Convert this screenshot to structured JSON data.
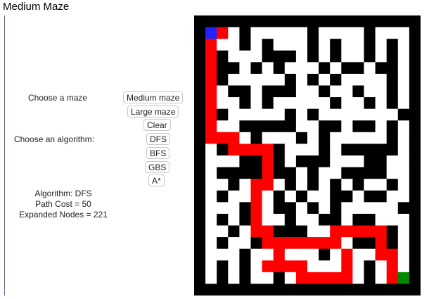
{
  "page_title": "Medium Maze",
  "controls": {
    "choose_maze_label": "Choose a maze",
    "choose_algorithm_label": "Choose an algorithm:",
    "buttons": {
      "medium_maze": "Medium maze",
      "large_maze": "Large  maze",
      "clear": "Clear",
      "dfs": "DFS",
      "bfs": "BFS",
      "gbs": "GBS",
      "astar": "A*"
    }
  },
  "results": {
    "algorithm": "Algorithm: DFS",
    "path_cost": "Path Cost = 50",
    "expanded_nodes": "Expanded Nodes = 221"
  },
  "maze": {
    "colors": {
      "wall": "#000000",
      "open": "#ffffff",
      "path": "#ff0000",
      "start": "#2222ff",
      "goal": "#008800"
    },
    "grid": [
      "####################",
      "#SP.#.....#....#...#",
      "#P..#.#...#.#..#.#.#",
      "#P#...###.#.#..#.#.#",
      "#P##.#.#...#.##.##.#",
      "#P#.....#.#.#....#.#",
      "#P.##.###..#..#..#.#",
      "#P..#.#.....#..#.#.#",
      "#P#.....#.#.......##",
      "#P..#####..##.##.#.#",
      "#PPP.#...#.#.....#.#",
      "#.#PPPP#...#.#####.#",
      "#...##P#.###...##..#",
      "#.####P##.#..####..#",
      "#..#.PP.#.#.#.#..#.#",
      "#.#..P.#.#..##.##..#",
      "#...#P.##.#.#.....##",
      "#.#.#P..#..##.##...#",
      "#..#.PP###..PPPPP#.#",
      "#.#..#PPPPPPP.##P#.#",
      "#...#..P...#.P..PP.#",
      "#.#.#.PPPP...P.#.P.#",
      "#.#.#..#.PPPPP.#.PG#",
      "####################"
    ]
  }
}
